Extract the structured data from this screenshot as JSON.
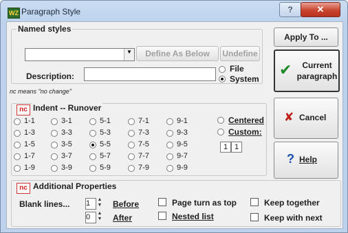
{
  "title": "Paragraph Style",
  "titlebar": {
    "help": "?",
    "close": "✕"
  },
  "named_styles": {
    "legend": "Named styles",
    "combo_value": "",
    "define_btn": "Define As Below",
    "undefine_btn": "Undefine",
    "description_label": "Description:",
    "description_value": "",
    "radio_file": "File",
    "radio_system": "System"
  },
  "note": "nc means \"no change\"",
  "indent": {
    "nc": "nc",
    "legend": "Indent -- Runover",
    "columns": [
      [
        "1-1",
        "1-3",
        "1-5",
        "1-7",
        "1-9"
      ],
      [
        "3-1",
        "3-3",
        "3-5",
        "3-7",
        "3-9"
      ],
      [
        "5-1",
        "5-3",
        "5-5",
        "5-7",
        "5-9"
      ],
      [
        "7-1",
        "7-3",
        "7-5",
        "7-7",
        "7-9"
      ],
      [
        "9-1",
        "9-3",
        "9-5",
        "9-7",
        "9-9"
      ]
    ],
    "selected": "5-5",
    "centered": "Centered",
    "custom": "Custom:",
    "custom_a": "1",
    "custom_b": "1"
  },
  "additional": {
    "nc": "nc",
    "legend": "Additional Properties",
    "blank_lines": "Blank lines...",
    "before_value": "1",
    "before_label": "Before",
    "after_value": "0",
    "after_label": "After",
    "page_turn": "Page turn as top",
    "nested": "Nested list",
    "keep_together": "Keep together",
    "keep_next": "Keep with next"
  },
  "side": {
    "apply_to": "Apply To ...",
    "current_1": "Current",
    "current_2": "paragraph",
    "cancel": "Cancel",
    "help": "Help"
  },
  "colors": {
    "check_green": "#1f8a2a",
    "cancel_red": "#c0201a",
    "help_blue": "#1a4fb0"
  }
}
